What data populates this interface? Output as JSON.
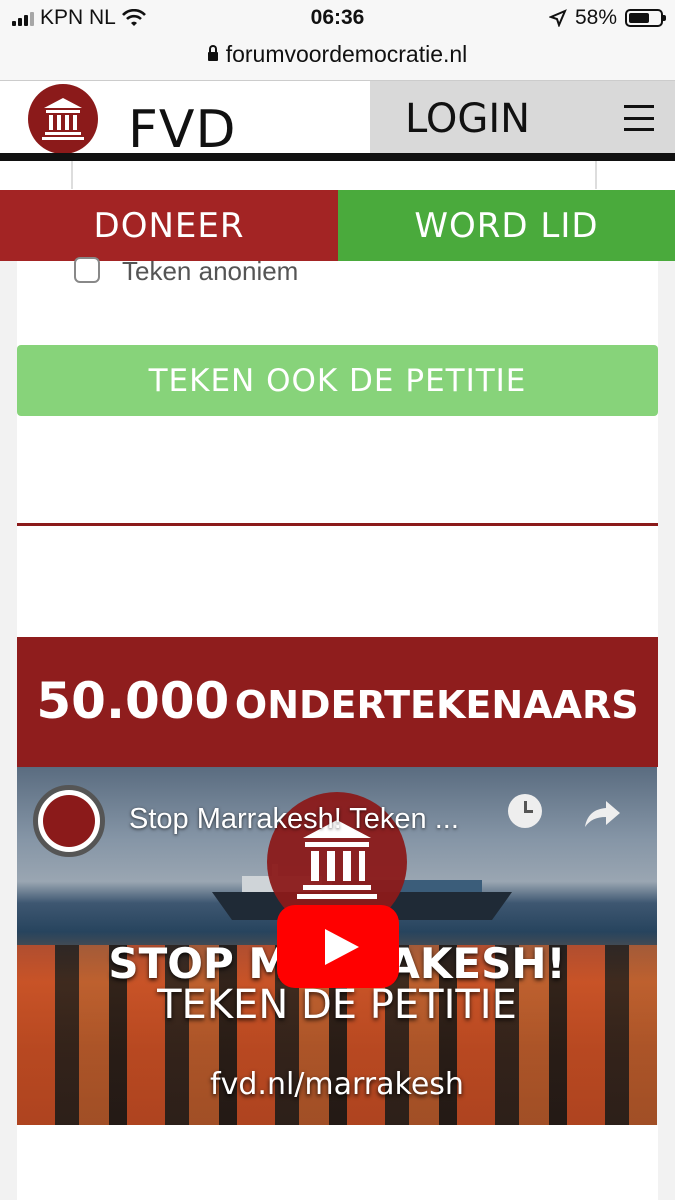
{
  "status_bar": {
    "carrier": "KPN NL",
    "time": "06:36",
    "battery": "58%"
  },
  "browser": {
    "url": "forumvoordemocratie.nl"
  },
  "header": {
    "logo_text": "FVD",
    "login_label": "LOGIN"
  },
  "actions": {
    "donate_label": "DONEER",
    "join_label": "WORD LID"
  },
  "form": {
    "anonymous_label": "Teken anoniem",
    "sign_button_label": "TEKEN OOK DE PETITIE"
  },
  "banner": {
    "count": "50.000",
    "count_label": "ONDERTEKENAARS"
  },
  "video": {
    "title": "Stop Marrakesh! Teken ...",
    "headline": "STOP MARRAKESH!",
    "subline": "TEKEN DE PETITIE",
    "url_text": "fvd.nl/marrakesh"
  },
  "colors": {
    "brand_red": "#8f1d1d",
    "donate_red": "#a32424",
    "join_green": "#4aaa3c",
    "petition_green": "#87d37a"
  }
}
